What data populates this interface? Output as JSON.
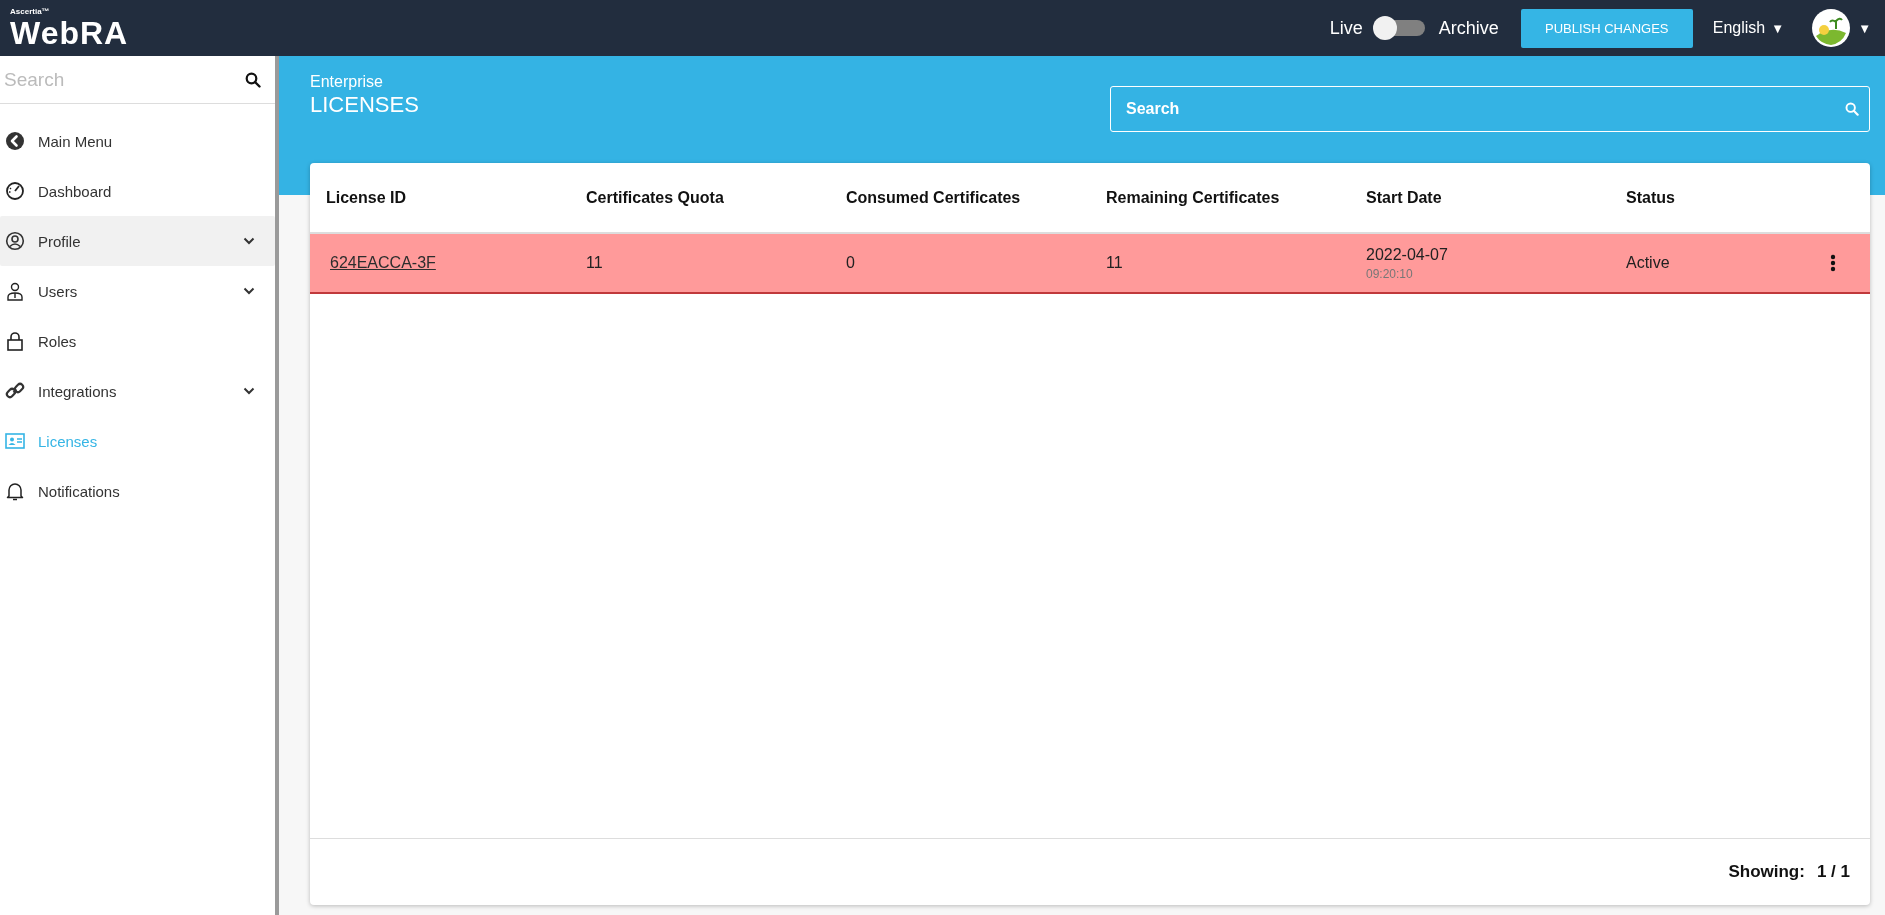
{
  "topbar": {
    "logo": {
      "brand": "Ascertia™",
      "product": "WebRA"
    },
    "mode_toggle": {
      "left_label": "Live",
      "right_label": "Archive",
      "on": false
    },
    "publish_button": "PUBLISH CHANGES",
    "language": {
      "label": "English",
      "caret": "▼"
    },
    "user_menu": {
      "caret": "▼"
    }
  },
  "sidebar": {
    "search": {
      "placeholder": "Search"
    },
    "items": [
      {
        "label": "Main Menu",
        "expandable": false,
        "highlighted": false,
        "selected": false
      },
      {
        "label": "Dashboard",
        "expandable": false,
        "highlighted": false,
        "selected": false
      },
      {
        "label": "Profile",
        "expandable": true,
        "highlighted": true,
        "selected": false
      },
      {
        "label": "Users",
        "expandable": true,
        "highlighted": false,
        "selected": false
      },
      {
        "label": "Roles",
        "expandable": false,
        "highlighted": false,
        "selected": false
      },
      {
        "label": "Integrations",
        "expandable": true,
        "highlighted": false,
        "selected": false
      },
      {
        "label": "Licenses",
        "expandable": false,
        "highlighted": false,
        "selected": true
      },
      {
        "label": "Notifications",
        "expandable": false,
        "highlighted": false,
        "selected": false
      }
    ]
  },
  "page_header": {
    "subtitle": "Enterprise",
    "title": "LICENSES",
    "search": {
      "placeholder": "Search"
    }
  },
  "table": {
    "columns": [
      "License ID",
      "Certificates Quota",
      "Consumed Certificates",
      "Remaining Certificates",
      "Start Date",
      "Status"
    ],
    "rows": [
      {
        "license_id": "624EACCA-3F",
        "certificates_quota": "11",
        "consumed_certificates": "0",
        "remaining_certificates": "11",
        "start_date": "2022-04-07",
        "start_time": "09:20:10",
        "status": "Active",
        "highlighted": true
      }
    ]
  },
  "footer": {
    "label": "Showing:",
    "value": "1 / 1"
  }
}
